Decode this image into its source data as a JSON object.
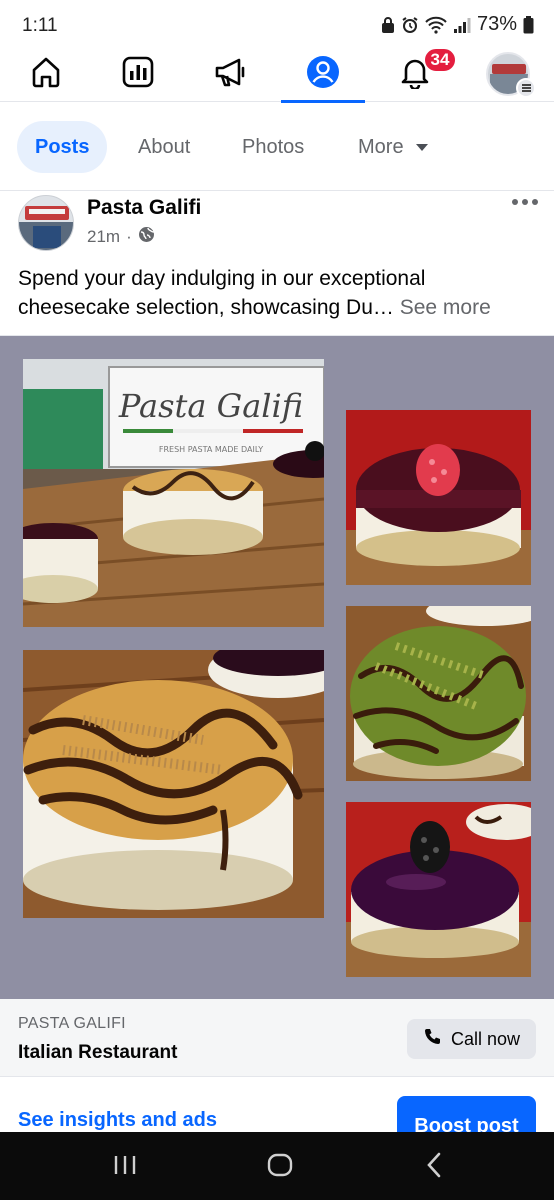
{
  "status_bar": {
    "time": "1:11",
    "battery": "73%"
  },
  "nav": {
    "notification_count": "34",
    "active_tab": "profile",
    "accent": "#0866ff"
  },
  "tabs": [
    {
      "label": "Posts",
      "active": true
    },
    {
      "label": "About",
      "active": false
    },
    {
      "label": "Photos",
      "active": false
    },
    {
      "label": "More",
      "active": false
    }
  ],
  "post": {
    "author": "Pasta Galifi",
    "time": "21m",
    "separator": "·",
    "text": "Spend your day indulging in our exceptional cheesecake selection, showcasing Du…",
    "see_more": "See more",
    "photos": [
      {
        "name": "storefront-sign-cheesecakes",
        "sign_text": "Pasta Galifi",
        "sign_sub": "FRESH PASTA MADE DAILY"
      },
      {
        "name": "caramel-chocolate-cheesecake"
      },
      {
        "name": "raspberry-cheesecake"
      },
      {
        "name": "pistachio-cheesecake"
      },
      {
        "name": "blackberry-cheesecake"
      }
    ]
  },
  "page_info": {
    "name": "PASTA GALIFI",
    "category": "Italian Restaurant",
    "call_label": "Call now"
  },
  "actions": {
    "insights_label": "See insights and ads",
    "boost_label": "Boost post"
  }
}
